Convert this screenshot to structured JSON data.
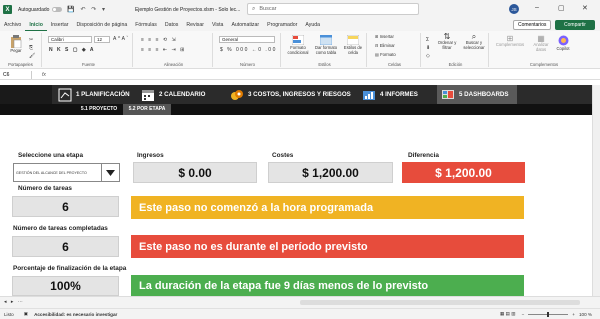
{
  "titlebar": {
    "autosave_label": "Autoguardado",
    "doc_title": "Ejemplo Gestión de Proyectos.xlsm  -  Solo lec...",
    "search_placeholder": "Buscar",
    "avatar_initials": "JS"
  },
  "tabs": [
    "Archivo",
    "Inicio",
    "Insertar",
    "Disposición de página",
    "Fórmulas",
    "Datos",
    "Revisar",
    "Vista",
    "Automatizar",
    "Programador",
    "Ayuda"
  ],
  "active_tab": "Inicio",
  "buttons": {
    "comments": "Comentarios",
    "share": "Compartir"
  },
  "ribbon": {
    "paste_label": "Pegar",
    "clipboard_label": "Portapapeles",
    "font_name": "Calibri",
    "font_size": "12",
    "font_label": "Fuente",
    "align_label": "Alineación",
    "number_format": "General",
    "number_label": "Número",
    "cond_format": "Formato condicional",
    "table_format": "Dar formato como tabla",
    "cell_styles": "Estilos de celda",
    "styles_label": "Estilos",
    "insert_label": "Insertar",
    "delete_label": "Eliminar",
    "format_label": "Formato",
    "cells_label": "Celdas",
    "sort_label": "Ordenar y filtrar",
    "find_label": "Buscar y seleccionar",
    "edit_label": "Edición",
    "addins_label": "Complementos",
    "analyze_label": "Analizar datos",
    "copilot_label": "Copilot",
    "complements_group": "Complementos"
  },
  "formula_bar": {
    "cell_ref": "C6",
    "fx": "fx"
  },
  "nav": [
    {
      "label": "1 PLANIFICACIÓN",
      "active": false
    },
    {
      "label": "2 CALENDARIO",
      "active": false
    },
    {
      "label": "3 COSTOS, INGRESOS Y RIESGOS",
      "active": false
    },
    {
      "label": "4 INFORMES",
      "active": false
    },
    {
      "label": "5 DASHBOARDS",
      "active": true
    }
  ],
  "subnav": [
    {
      "label": "5.1 PROYECTO",
      "active": false
    },
    {
      "label": "5.2 POR ETAPA",
      "active": true
    }
  ],
  "dashboard": {
    "select_stage_label": "Seleccione una etapa",
    "select_stage_value": "GESTIÓN DEL ALCANCE DEL PROYECTO",
    "ingresos_label": "Ingresos",
    "ingresos_value": "$ 0.00",
    "costes_label": "Costes",
    "costes_value": "$ 1,200.00",
    "diferencia_label": "Diferencia",
    "diferencia_value": "$ 1,200.00",
    "num_tareas_label": "Número de tareas",
    "num_tareas_value": "6",
    "num_completadas_label": "Número de tareas completadas",
    "num_completadas_value": "6",
    "porcentaje_label": "Porcentaje de finalización de la etapa",
    "porcentaje_value": "100%",
    "banner1": "Este paso no comenzó a la hora programada",
    "banner2": "Este paso no es durante el período previsto",
    "banner3": "La duración de la etapa fue 9 días menos de lo previsto"
  },
  "statusbar": {
    "ready": "Listo",
    "accessibility": "Accesibilidad: es necesario investigar",
    "zoom": "100 %"
  },
  "colors": {
    "excel_green": "#1e7145",
    "banner_yellow": "#f0b323",
    "banner_red": "#e74c3c",
    "banner_green": "#4cae4f",
    "nav_dark": "#2b2b2b"
  }
}
